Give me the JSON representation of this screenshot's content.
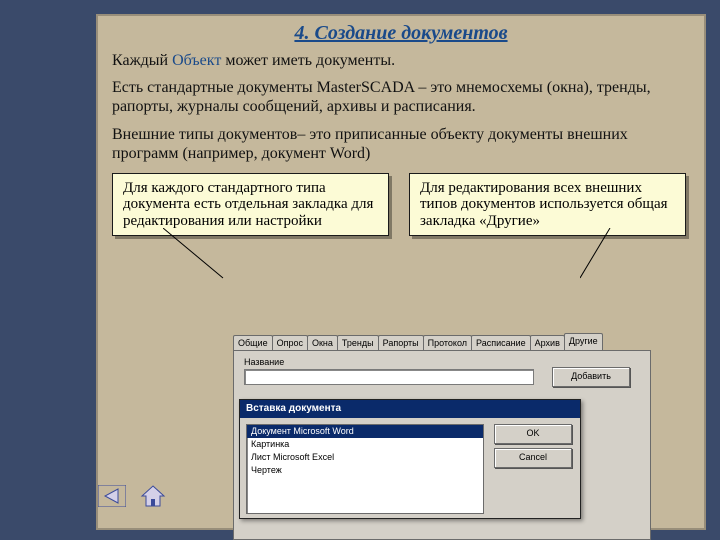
{
  "title": "4. Создание документов",
  "para1_pre": "Каждый ",
  "para1_kw": "Объект",
  "para1_post": " может иметь документы.",
  "para2": "Есть стандартные документы MasterSCADA – это мнемосхемы (окна), тренды, рапорты, журналы сообщений, архивы и расписания.",
  "para3": "Внешние типы документов– это приписанные объекту документы внешних программ (например, документ Word)",
  "callout_left": "Для каждого стандартного типа документа есть отдельная закладка для редактирования или настройки",
  "callout_right": "Для редактирования всех внешних типов документов используется общая закладка «Другие»",
  "screenshot": {
    "tabs": [
      "Общие",
      "Опрос",
      "Окна",
      "Тренды",
      "Рапорты",
      "Протокол",
      "Расписание",
      "Архив",
      "Другие"
    ],
    "active_tab_index": 8,
    "name_label": "Название",
    "add_btn": "Добавить",
    "dialog": {
      "title": "Вставка документа",
      "items": [
        "Документ Microsoft Word",
        "Картинка",
        "Лист Microsoft Excel",
        "Чертеж"
      ],
      "selected_index": 0,
      "ok": "OK",
      "cancel": "Cancel"
    }
  }
}
